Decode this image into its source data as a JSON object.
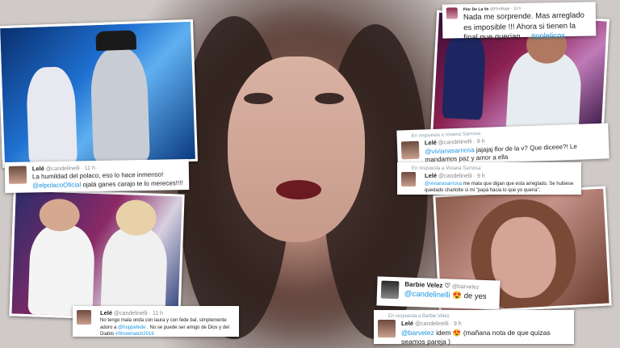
{
  "tweets": [
    {
      "author": "Lelé",
      "handle": "@candelinelli",
      "time": "· 11 h",
      "text_a": "La humildad del polaco, eso lo hace inmenso! ",
      "mention": "@elpolacoOficial",
      "text_b": " ojalá ganes carajo te lo mereces!!!!"
    },
    {
      "author": "Lelé",
      "handle": "@candelinelli",
      "time": "· 11 h",
      "text_a": "No tengo mala onda con laura y con fede bal, simplemente adoro a ",
      "mention": "@hoppefede",
      "text_b": " . No se puede ser amigo de Dios y del Diablo ",
      "hashtag": "#Showmatch2016"
    },
    {
      "author": "Flor De La Ve",
      "handle": "@FlorMaje",
      "time": "· 10 h",
      "text": "Nada me sorprende. Mas arreglado es imposible !!! Ahora si tienen la final   que querian ... ",
      "hashtag": "#polelicos"
    },
    {
      "reply_to": "En respuesta a Viviana Sarnosa",
      "author": "Lelé",
      "handle": "@candelinelli",
      "time": "· 9 h",
      "mention": "@vivianasarnosa",
      "text": " jajajaj flor de la v? Que diceee?! Le mandamos paz y amor a ella"
    },
    {
      "reply_to": "En respuesta a Viviana Sarnosa",
      "author": "Lelé",
      "handle": "@candelinelli",
      "time": "· 9 h",
      "mention": "@vivianasarnosa",
      "text": " me mata que digan que esta arreglado. Se hubiese quedado charlotte si mi \"papá hacia lo que yo queria\"."
    },
    {
      "author": "Barbie Velez ♡",
      "handle": "@barvelez",
      "mention": "@candelinelli",
      "text": " 😍 de yes"
    },
    {
      "reply_to": "En respuesta a Barbie Velez",
      "author": "Lelé",
      "handle": "@candelinelli",
      "time": "· 9 h",
      "mention": "@barvelez",
      "text": " idem 😍 (mañana nota de que quizas seamos pareja )"
    }
  ]
}
